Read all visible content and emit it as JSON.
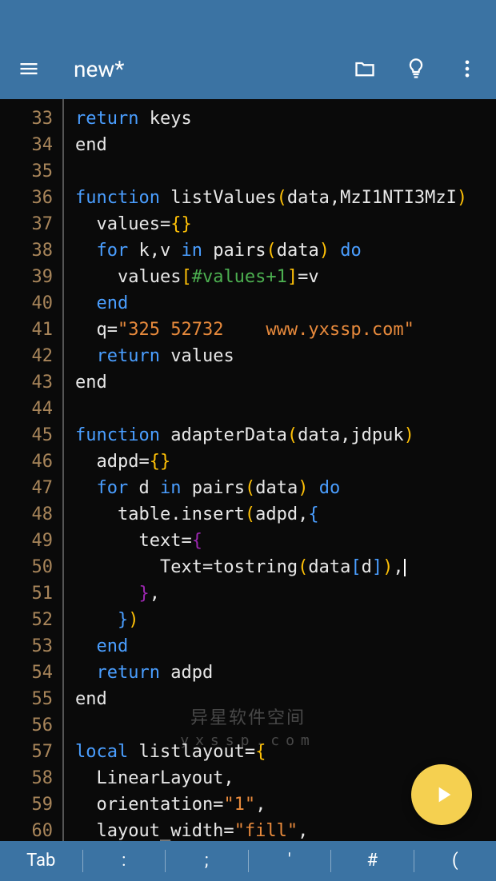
{
  "toolbar": {
    "title": "new*"
  },
  "editor": {
    "first_line": 33,
    "lines": [
      [
        [
          "kw",
          "return"
        ],
        [
          "",
          " keys"
        ]
      ],
      [
        [
          "",
          "end"
        ]
      ],
      [
        [
          "",
          ""
        ]
      ],
      [
        [
          "kw",
          "function"
        ],
        [
          "",
          " listValues"
        ],
        [
          "bracket1",
          "("
        ],
        [
          "",
          "data,MzI1NTI3MzI"
        ],
        [
          "bracket1",
          ")"
        ]
      ],
      [
        [
          "",
          "  values="
        ],
        [
          "bracket1",
          "{}"
        ]
      ],
      [
        [
          "",
          "  "
        ],
        [
          "kw",
          "for"
        ],
        [
          "",
          " k,v "
        ],
        [
          "kw",
          "in"
        ],
        [
          "",
          " pairs"
        ],
        [
          "bracket1",
          "("
        ],
        [
          "",
          "data"
        ],
        [
          "bracket1",
          ")"
        ],
        [
          "",
          " "
        ],
        [
          "kw",
          "do"
        ]
      ],
      [
        [
          "",
          "    values"
        ],
        [
          "bracket1",
          "["
        ],
        [
          "comment-token",
          "#values+1"
        ],
        [
          "bracket1",
          "]"
        ],
        [
          "",
          "=v"
        ]
      ],
      [
        [
          "",
          "  "
        ],
        [
          "kw",
          "end"
        ]
      ],
      [
        [
          "",
          "  q="
        ],
        [
          "str",
          "\"325 52732    www.yxssp.com\""
        ]
      ],
      [
        [
          "",
          "  "
        ],
        [
          "kw",
          "return"
        ],
        [
          "",
          " values"
        ]
      ],
      [
        [
          "",
          "end"
        ]
      ],
      [
        [
          "",
          ""
        ]
      ],
      [
        [
          "kw",
          "function"
        ],
        [
          "",
          " adapterData"
        ],
        [
          "bracket1",
          "("
        ],
        [
          "",
          "data,jdpuk"
        ],
        [
          "bracket1",
          ")"
        ]
      ],
      [
        [
          "",
          "  adpd="
        ],
        [
          "bracket1",
          "{}"
        ]
      ],
      [
        [
          "",
          "  "
        ],
        [
          "kw",
          "for"
        ],
        [
          "",
          " d "
        ],
        [
          "kw",
          "in"
        ],
        [
          "",
          " pairs"
        ],
        [
          "bracket1",
          "("
        ],
        [
          "",
          "data"
        ],
        [
          "bracket1",
          ")"
        ],
        [
          "",
          " "
        ],
        [
          "kw",
          "do"
        ]
      ],
      [
        [
          "",
          "    table.insert"
        ],
        [
          "bracket1",
          "("
        ],
        [
          "",
          "adpd,"
        ],
        [
          "bracket2",
          "{"
        ]
      ],
      [
        [
          "",
          "      text="
        ],
        [
          "bracket3",
          "{"
        ]
      ],
      [
        [
          "",
          "        Text=tostring"
        ],
        [
          "bracket1",
          "("
        ],
        [
          "",
          "data"
        ],
        [
          "bracket2",
          "["
        ],
        [
          "",
          "d"
        ],
        [
          "bracket2",
          "]"
        ],
        [
          "bracket1",
          ")"
        ],
        [
          "",
          ","
        ],
        [
          "cursor",
          ""
        ]
      ],
      [
        [
          "",
          "      "
        ],
        [
          "bracket3",
          "}"
        ],
        [
          "",
          ","
        ]
      ],
      [
        [
          "",
          "    "
        ],
        [
          "bracket2",
          "}"
        ],
        [
          "bracket1",
          ")"
        ]
      ],
      [
        [
          "",
          "  "
        ],
        [
          "kw",
          "end"
        ]
      ],
      [
        [
          "",
          "  "
        ],
        [
          "kw",
          "return"
        ],
        [
          "",
          " adpd"
        ]
      ],
      [
        [
          "",
          "end"
        ]
      ],
      [
        [
          "",
          ""
        ]
      ],
      [
        [
          "kw",
          "local"
        ],
        [
          "",
          " listlayout="
        ],
        [
          "bracket1",
          "{"
        ]
      ],
      [
        [
          "",
          "  LinearLayout,"
        ]
      ],
      [
        [
          "",
          "  orientation="
        ],
        [
          "str",
          "\"1\""
        ],
        [
          "",
          ","
        ]
      ],
      [
        [
          "",
          "  layout_width="
        ],
        [
          "str",
          "\"fill\""
        ],
        [
          "",
          ","
        ]
      ]
    ]
  },
  "watermark": {
    "main": "异星软件空间",
    "sub": "yxssp.com"
  },
  "bottom_bar": {
    "items": [
      "Tab",
      ":",
      ";",
      "'",
      "#",
      "("
    ]
  },
  "colors": {
    "primary": "#3b73a3",
    "fab": "#f5d050",
    "gutter": "#a8855a"
  }
}
